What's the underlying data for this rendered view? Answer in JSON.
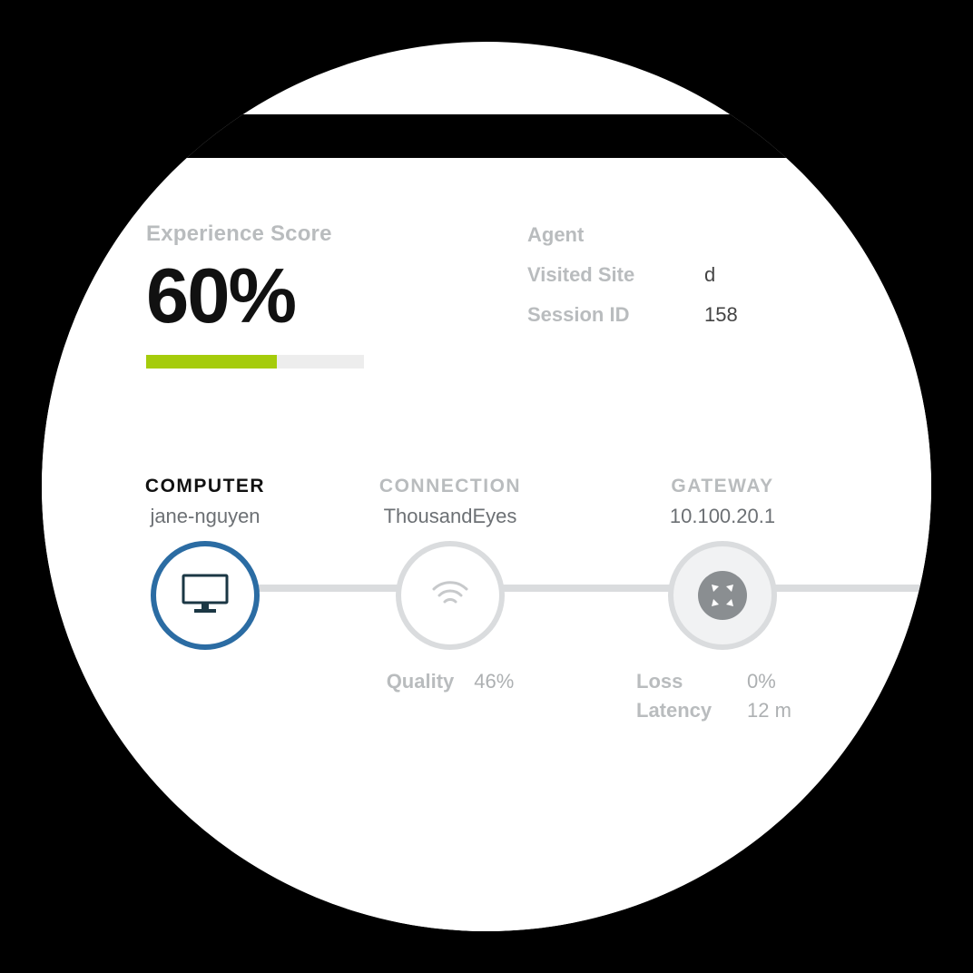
{
  "window": {
    "traffic_lights": [
      "close",
      "minimize",
      "zoom"
    ]
  },
  "score": {
    "label": "Experience Score",
    "value": "60%",
    "percent": 60
  },
  "meta": {
    "agent_key": "Agent",
    "agent_val": "",
    "site_key": "Visited Site",
    "site_val": "d",
    "session_key": "Session ID",
    "session_val": "158"
  },
  "path": {
    "computer": {
      "header": "COMPUTER",
      "sub": "jane-nguyen",
      "icon": "monitor-icon"
    },
    "connection": {
      "header": "CONNECTION",
      "sub": "ThousandEyes",
      "icon": "wifi-icon",
      "metrics": {
        "quality_key": "Quality",
        "quality_val": "46%"
      }
    },
    "gateway": {
      "header": "GATEWAY",
      "sub": "10.100.20.1",
      "icon": "arrows-out-icon",
      "metrics": {
        "loss_key": "Loss",
        "loss_val": "0%",
        "latency_key": "Latency",
        "latency_val": "12 m"
      }
    }
  }
}
